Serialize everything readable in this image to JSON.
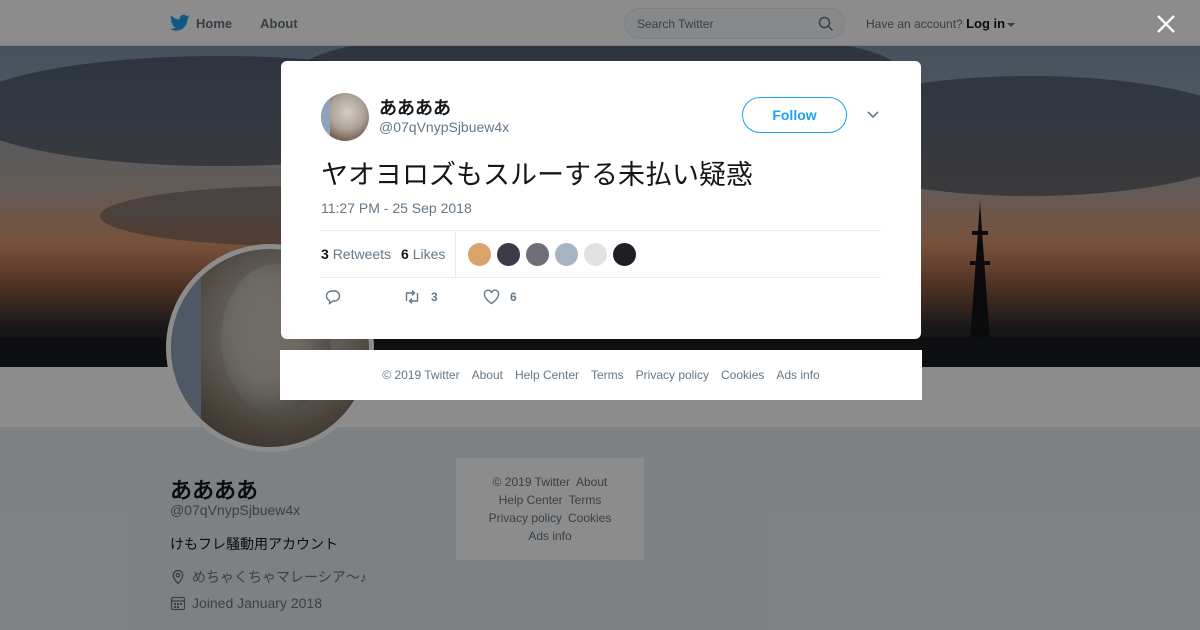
{
  "nav": {
    "home": "Home",
    "about": "About",
    "search_placeholder": "Search Twitter",
    "have_account": "Have an account?",
    "login": "Log in"
  },
  "profile": {
    "name": "ああああ",
    "handle": "@07qVnypSjbuew4x",
    "bio": "けもフレ騒動用アカウント",
    "location": "めちゃくちゃマレーシア～♪",
    "joined": "Joined January 2018"
  },
  "side_footer": {
    "copyright": "© 2019 Twitter",
    "about": "About",
    "help": "Help Center",
    "terms": "Terms",
    "privacy": "Privacy policy",
    "cookies": "Cookies",
    "ads": "Ads info"
  },
  "tweet": {
    "name": "ああああ",
    "handle": "@07qVnypSjbuew4x",
    "follow": "Follow",
    "text": "ヤオヨロズもスルーする未払い疑惑",
    "time": "11:27 PM - 25 Sep 2018",
    "retweets_count": "3",
    "retweets_label": "Retweets",
    "likes_count": "6",
    "likes_label": "Likes",
    "action_retweets": "3",
    "action_likes": "6"
  },
  "liker_colors": [
    "#d9a36a",
    "#3a3a48",
    "#6e6e76",
    "#a9b4c2",
    "#e2e2e2",
    "#1e1e24"
  ],
  "modal_footer": {
    "copyright": "© 2019 Twitter",
    "about": "About",
    "help": "Help Center",
    "terms": "Terms",
    "privacy": "Privacy policy",
    "cookies": "Cookies",
    "ads": "Ads info"
  }
}
